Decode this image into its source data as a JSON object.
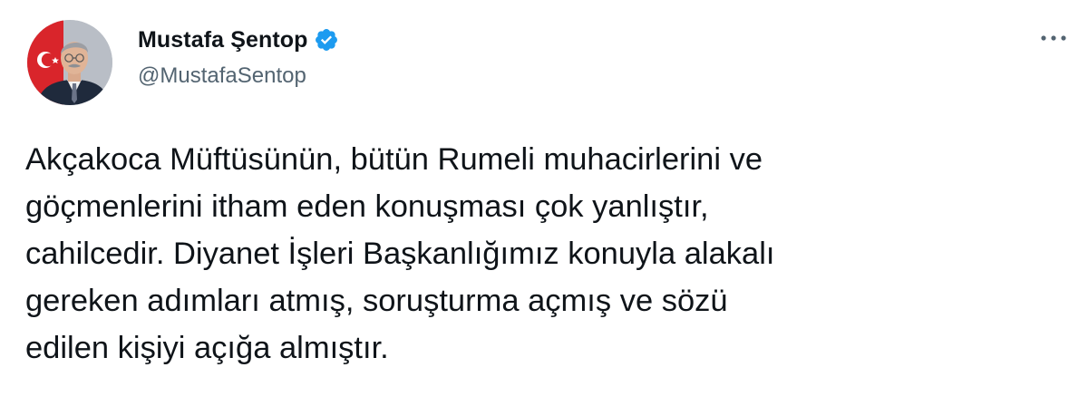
{
  "author": {
    "display_name": "Mustafa Şentop",
    "handle": "@MustafaSentop",
    "verified": true
  },
  "tweet": {
    "text": "Akçakoca Müftüsünün, bütün Rumeli muhacirlerini ve\ngöçmenlerini itham eden konuşması çok yanlıştır,\ncahilcedir. Diyanet İşleri Başkanlığımız konuyla alakalı\ngereken adımları atmış, soruşturma açmış ve sözü\nedilen kişiyi açığa almıştır."
  },
  "icons": {
    "verified": "verified-badge-icon",
    "more": "more-options-icon"
  },
  "colors": {
    "text": "#0f1419",
    "secondary_text": "#536471",
    "verified_blue": "#1d9bf0",
    "background": "#ffffff"
  }
}
